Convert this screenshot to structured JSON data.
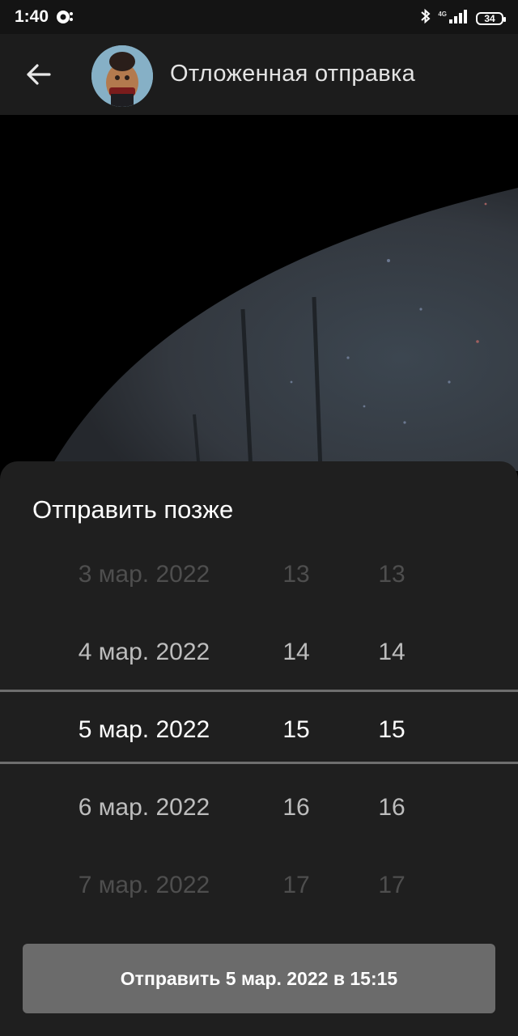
{
  "status_bar": {
    "time": "1:40",
    "network": "4G",
    "battery": "34",
    "icons": [
      "notification-icon",
      "bluetooth-icon",
      "signal-icon",
      "battery-icon"
    ]
  },
  "app_bar": {
    "back_icon": "arrow-back-icon",
    "avatar_icon": "avatar-image",
    "title": "Отложенная отправка"
  },
  "sheet": {
    "title": "Отправить позже",
    "picker": {
      "rows": [
        {
          "date": "3 мар. 2022",
          "hour": "13",
          "minute": "13"
        },
        {
          "date": "4 мар. 2022",
          "hour": "14",
          "minute": "14"
        },
        {
          "date": "5 мар. 2022",
          "hour": "15",
          "minute": "15"
        },
        {
          "date": "6 мар. 2022",
          "hour": "16",
          "minute": "16"
        },
        {
          "date": "7 мар. 2022",
          "hour": "17",
          "minute": "17"
        }
      ],
      "selected_index": 2
    },
    "send_button_label": "Отправить 5 мар. 2022 в 15:15"
  },
  "colors": {
    "sheet_bg": "#1f1f1f",
    "app_bar_bg": "#1c1c1c",
    "button_bg": "#6b6b6b",
    "divider": "#6e6e6e"
  }
}
